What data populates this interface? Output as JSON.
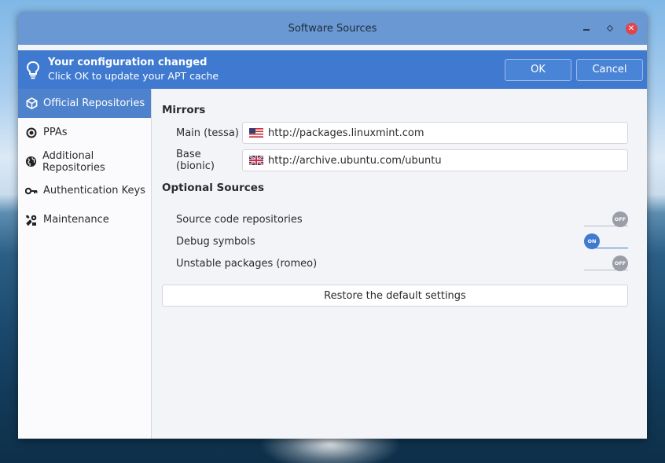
{
  "window": {
    "title": "Software Sources",
    "minimize_icon": "minimize-icon",
    "maximize_icon": "maximize-icon",
    "close_icon": "close-icon",
    "close_glyph": "✕"
  },
  "infobar": {
    "icon": "lightbulb-icon",
    "title": "Your configuration changed",
    "subtitle": "Click OK to update your APT cache",
    "ok_label": "OK",
    "cancel_label": "Cancel"
  },
  "sidebar": {
    "items": [
      {
        "label": "Official Repositories",
        "icon": "package-icon",
        "active": true
      },
      {
        "label": "PPAs",
        "icon": "ppa-icon",
        "active": false
      },
      {
        "label": "Additional Repositories",
        "icon": "globe-icon",
        "active": false
      },
      {
        "label": "Authentication Keys",
        "icon": "key-icon",
        "active": false
      },
      {
        "label": "Maintenance",
        "icon": "tools-icon",
        "active": false
      }
    ]
  },
  "mirrors": {
    "title": "Mirrors",
    "main": {
      "label": "Main (tessa)",
      "url": "http://packages.linuxmint.com",
      "flag": "us-flag-icon"
    },
    "base": {
      "label": "Base (bionic)",
      "url": "http://archive.ubuntu.com/ubuntu",
      "flag": "uk-flag-icon"
    }
  },
  "optional": {
    "title": "Optional Sources",
    "items": [
      {
        "label": "Source code repositories",
        "state": "OFF"
      },
      {
        "label": "Debug symbols",
        "state": "ON"
      },
      {
        "label": "Unstable packages (romeo)",
        "state": "OFF"
      }
    ]
  },
  "restore_label": "Restore the default settings",
  "colors": {
    "titlebar": "#6a98d2",
    "infobar": "#3f7ad0",
    "accent": "#4e82cc",
    "close": "#e2444c"
  }
}
